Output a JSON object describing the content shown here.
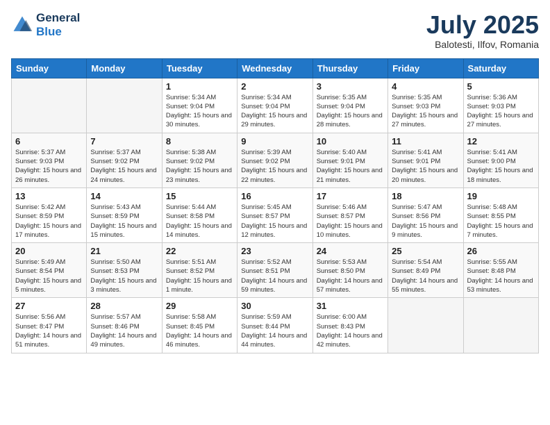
{
  "header": {
    "logo_line1": "General",
    "logo_line2": "Blue",
    "month": "July 2025",
    "location": "Balotesti, Ilfov, Romania"
  },
  "weekdays": [
    "Sunday",
    "Monday",
    "Tuesday",
    "Wednesday",
    "Thursday",
    "Friday",
    "Saturday"
  ],
  "weeks": [
    [
      {
        "day": "",
        "info": ""
      },
      {
        "day": "",
        "info": ""
      },
      {
        "day": "1",
        "info": "Sunrise: 5:34 AM\nSunset: 9:04 PM\nDaylight: 15 hours and 30 minutes."
      },
      {
        "day": "2",
        "info": "Sunrise: 5:34 AM\nSunset: 9:04 PM\nDaylight: 15 hours and 29 minutes."
      },
      {
        "day": "3",
        "info": "Sunrise: 5:35 AM\nSunset: 9:04 PM\nDaylight: 15 hours and 28 minutes."
      },
      {
        "day": "4",
        "info": "Sunrise: 5:35 AM\nSunset: 9:03 PM\nDaylight: 15 hours and 27 minutes."
      },
      {
        "day": "5",
        "info": "Sunrise: 5:36 AM\nSunset: 9:03 PM\nDaylight: 15 hours and 27 minutes."
      }
    ],
    [
      {
        "day": "6",
        "info": "Sunrise: 5:37 AM\nSunset: 9:03 PM\nDaylight: 15 hours and 26 minutes."
      },
      {
        "day": "7",
        "info": "Sunrise: 5:37 AM\nSunset: 9:02 PM\nDaylight: 15 hours and 24 minutes."
      },
      {
        "day": "8",
        "info": "Sunrise: 5:38 AM\nSunset: 9:02 PM\nDaylight: 15 hours and 23 minutes."
      },
      {
        "day": "9",
        "info": "Sunrise: 5:39 AM\nSunset: 9:02 PM\nDaylight: 15 hours and 22 minutes."
      },
      {
        "day": "10",
        "info": "Sunrise: 5:40 AM\nSunset: 9:01 PM\nDaylight: 15 hours and 21 minutes."
      },
      {
        "day": "11",
        "info": "Sunrise: 5:41 AM\nSunset: 9:01 PM\nDaylight: 15 hours and 20 minutes."
      },
      {
        "day": "12",
        "info": "Sunrise: 5:41 AM\nSunset: 9:00 PM\nDaylight: 15 hours and 18 minutes."
      }
    ],
    [
      {
        "day": "13",
        "info": "Sunrise: 5:42 AM\nSunset: 8:59 PM\nDaylight: 15 hours and 17 minutes."
      },
      {
        "day": "14",
        "info": "Sunrise: 5:43 AM\nSunset: 8:59 PM\nDaylight: 15 hours and 15 minutes."
      },
      {
        "day": "15",
        "info": "Sunrise: 5:44 AM\nSunset: 8:58 PM\nDaylight: 15 hours and 14 minutes."
      },
      {
        "day": "16",
        "info": "Sunrise: 5:45 AM\nSunset: 8:57 PM\nDaylight: 15 hours and 12 minutes."
      },
      {
        "day": "17",
        "info": "Sunrise: 5:46 AM\nSunset: 8:57 PM\nDaylight: 15 hours and 10 minutes."
      },
      {
        "day": "18",
        "info": "Sunrise: 5:47 AM\nSunset: 8:56 PM\nDaylight: 15 hours and 9 minutes."
      },
      {
        "day": "19",
        "info": "Sunrise: 5:48 AM\nSunset: 8:55 PM\nDaylight: 15 hours and 7 minutes."
      }
    ],
    [
      {
        "day": "20",
        "info": "Sunrise: 5:49 AM\nSunset: 8:54 PM\nDaylight: 15 hours and 5 minutes."
      },
      {
        "day": "21",
        "info": "Sunrise: 5:50 AM\nSunset: 8:53 PM\nDaylight: 15 hours and 3 minutes."
      },
      {
        "day": "22",
        "info": "Sunrise: 5:51 AM\nSunset: 8:52 PM\nDaylight: 15 hours and 1 minute."
      },
      {
        "day": "23",
        "info": "Sunrise: 5:52 AM\nSunset: 8:51 PM\nDaylight: 14 hours and 59 minutes."
      },
      {
        "day": "24",
        "info": "Sunrise: 5:53 AM\nSunset: 8:50 PM\nDaylight: 14 hours and 57 minutes."
      },
      {
        "day": "25",
        "info": "Sunrise: 5:54 AM\nSunset: 8:49 PM\nDaylight: 14 hours and 55 minutes."
      },
      {
        "day": "26",
        "info": "Sunrise: 5:55 AM\nSunset: 8:48 PM\nDaylight: 14 hours and 53 minutes."
      }
    ],
    [
      {
        "day": "27",
        "info": "Sunrise: 5:56 AM\nSunset: 8:47 PM\nDaylight: 14 hours and 51 minutes."
      },
      {
        "day": "28",
        "info": "Sunrise: 5:57 AM\nSunset: 8:46 PM\nDaylight: 14 hours and 49 minutes."
      },
      {
        "day": "29",
        "info": "Sunrise: 5:58 AM\nSunset: 8:45 PM\nDaylight: 14 hours and 46 minutes."
      },
      {
        "day": "30",
        "info": "Sunrise: 5:59 AM\nSunset: 8:44 PM\nDaylight: 14 hours and 44 minutes."
      },
      {
        "day": "31",
        "info": "Sunrise: 6:00 AM\nSunset: 8:43 PM\nDaylight: 14 hours and 42 minutes."
      },
      {
        "day": "",
        "info": ""
      },
      {
        "day": "",
        "info": ""
      }
    ]
  ]
}
